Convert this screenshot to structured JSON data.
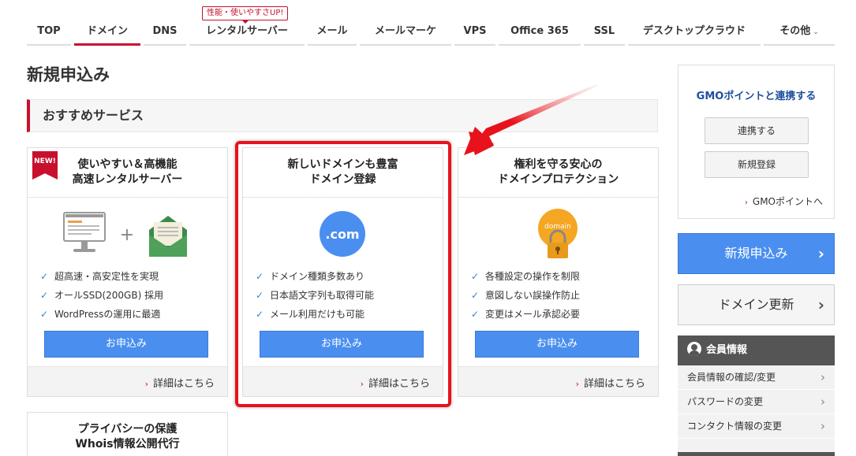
{
  "nav": {
    "items": [
      {
        "label": "TOP"
      },
      {
        "label": "ドメイン"
      },
      {
        "label": "DNS"
      },
      {
        "label": "レンタルサーバー"
      },
      {
        "label": "メール"
      },
      {
        "label": "メールマーケ"
      },
      {
        "label": "VPS"
      },
      {
        "label": "Office 365"
      },
      {
        "label": "SSL"
      },
      {
        "label": "デスクトップクラウド"
      },
      {
        "label": "その他"
      }
    ],
    "badge": "性能・使いやすさUP!",
    "active": "ドメイン"
  },
  "page": {
    "title": "新規申込み",
    "section_title": "おすすめサービス"
  },
  "cards": [
    {
      "badge": "NEW!",
      "title_line1": "使いやすい＆高機能",
      "title_line2": "高速レンタルサーバー",
      "features": [
        "超高速・高安定性を実現",
        "オールSSD(200GB) 採用",
        "WordPressの運用に最適"
      ],
      "button": "お申込み",
      "detail": "詳細はこちら"
    },
    {
      "title_line1": "新しいドメインも豊富",
      "title_line2": "ドメイン登録",
      "icon_text": ".com",
      "features": [
        "ドメイン種類多数あり",
        "日本語文字列も取得可能",
        "メール利用だけも可能"
      ],
      "button": "お申込み",
      "detail": "詳細はこちら"
    },
    {
      "title_line1": "権利を守る安心の",
      "title_line2": "ドメインプロテクション",
      "icon_text": "domain",
      "features": [
        "各種設定の操作を制限",
        "意図しない誤操作防止",
        "変更はメール承認必要"
      ],
      "button": "お申込み",
      "detail": "詳細はこちら"
    },
    {
      "title_line1": "プライバシーの保護",
      "title_line2": "Whois情報公開代行"
    }
  ],
  "sidebar": {
    "gmo_title": "GMOポイントと連携する",
    "link_button": "連携する",
    "register_button": "新規登録",
    "gmo_link": "GMOポイントへ",
    "new_apply": "新規申込み",
    "renew": "ドメイン更新",
    "member_title": "会員情報",
    "member_items": [
      "会員情報の確認/変更",
      "パスワードの変更",
      "コンタクト情報の変更"
    ]
  },
  "colors": {
    "brand_red": "#c8102e",
    "button_blue": "#4a8ff0",
    "highlight_red": "#e8121c"
  }
}
